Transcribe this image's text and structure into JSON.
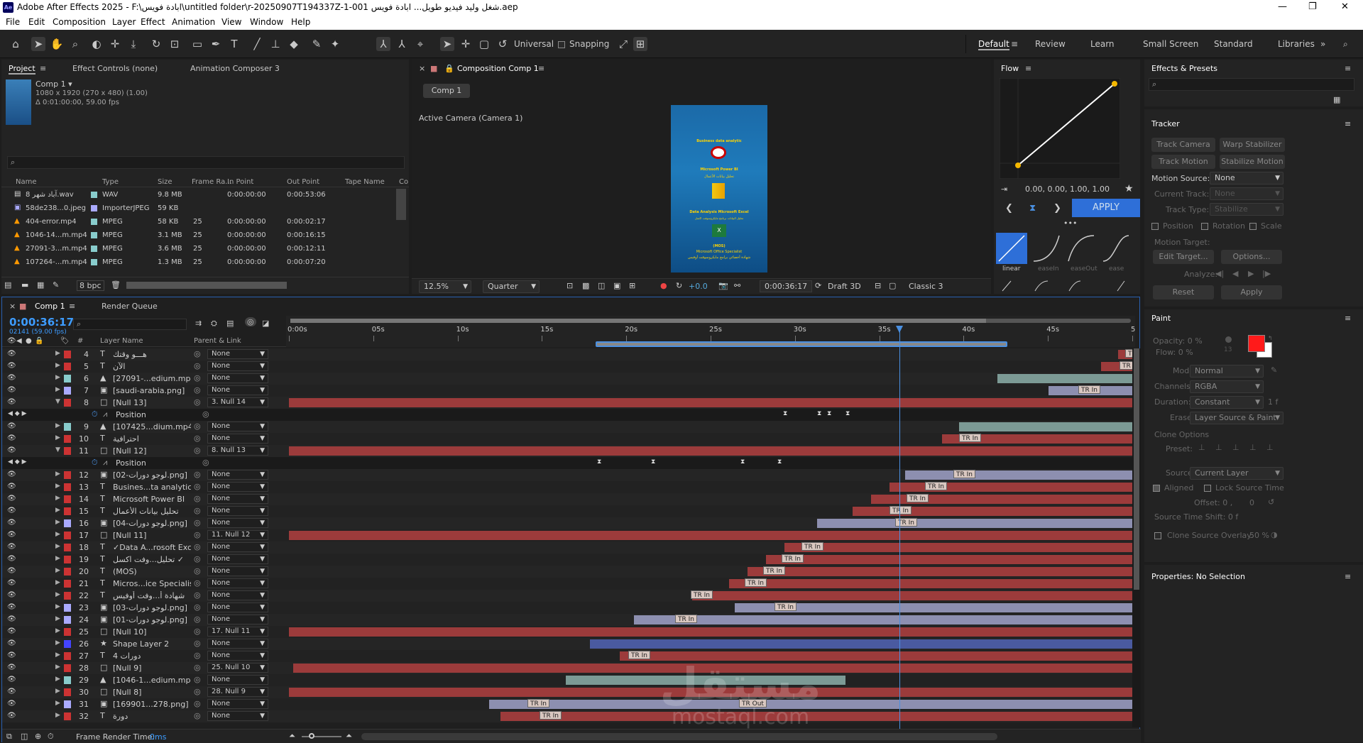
{
  "window": {
    "title": "Adobe After Effects 2025 - F:\\ابادة فويس\\untitled folder\\r-20250907T194337Z-1-001 شغل وليد فيديو طويل... ابادة فويس.aep",
    "min": "—",
    "max": "❐",
    "close": "✕",
    "logo": "Ae"
  },
  "menu": [
    "File",
    "Edit",
    "Composition",
    "Layer",
    "Effect",
    "Animation",
    "View",
    "Window",
    "Help"
  ],
  "toolbar": {
    "universal": "Universal",
    "snapping": "Snapping"
  },
  "workspaces": [
    "Default",
    "Review",
    "Learn",
    "Small Screen",
    "Standard",
    "Libraries"
  ],
  "project": {
    "tabs": [
      "Project",
      "Effect Controls (none)",
      "Animation Composer 3"
    ],
    "comp_name": "Comp 1 ▾",
    "comp_info1": "1080 x 1920  (270 x 480) (1.00)",
    "comp_info2": "Δ 0:01:00:00, 59.00 fps",
    "search_icon": "search-icon",
    "columns": [
      "Name",
      "Type",
      "Size",
      "Frame Ra...",
      "In Point",
      "Out Point",
      "Tape Name",
      "Co"
    ],
    "rows": [
      {
        "name": "8 آباد شهر.wav",
        "type": "WAV",
        "size": "9.8 MB",
        "fps": "",
        "in": "0:00:00:00",
        "out": "0:00:53:06"
      },
      {
        "name": "58de238...0.jpeg",
        "type": "ImporterJPEG",
        "size": "59 KB",
        "fps": "",
        "in": "",
        "out": ""
      },
      {
        "name": "404-error.mp4",
        "type": "MPEG",
        "size": "58 KB",
        "fps": "25",
        "in": "0:00:00:00",
        "out": "0:00:02:17"
      },
      {
        "name": "1046-14...m.mp4",
        "type": "MPEG",
        "size": "3.1 MB",
        "fps": "25",
        "in": "0:00:00:00",
        "out": "0:00:16:15"
      },
      {
        "name": "27091-3...m.mp4",
        "type": "MPEG",
        "size": "3.6 MB",
        "fps": "25",
        "in": "0:00:00:00",
        "out": "0:00:12:11"
      },
      {
        "name": "107264-...m.mp4",
        "type": "MPEG",
        "size": "1.3 MB",
        "fps": "25",
        "in": "0:00:00:00",
        "out": "0:00:07:20"
      }
    ],
    "bpc": "8 bpc"
  },
  "composition": {
    "tab": "Composition Comp 1",
    "crumb": "Comp 1",
    "camera": "Active Camera (Camera 1)",
    "zoom": "12.5%",
    "quality": "Quarter",
    "exposure": "+0.0",
    "time": "0:00:36:17",
    "renderer": "Draft 3D",
    "classic": "Classic 3",
    "preview_texts": [
      "Business data analytic",
      "Microsoft Power BI",
      "تحليل بيانات الأعمال",
      "Data Analysis Microsoft Excel",
      "تحليل البيانات برنامج مايكروسوفت اكسل",
      "(MOS)",
      "Microsoft Office Specialist",
      "شهادة أخصائي برامج مايكروسوفت أوفيس"
    ]
  },
  "flow": {
    "title": "Flow",
    "values": "0.00, 0.00, 1.00, 1.00",
    "apply": "APPLY",
    "presets": [
      "linear",
      "easeIn",
      "easeOut",
      "ease"
    ]
  },
  "effects": {
    "title": "Effects & Presets"
  },
  "tracker": {
    "title": "Tracker",
    "btns": [
      "Track Camera",
      "Warp Stabilizer",
      "Track Motion",
      "Stabilize Motion"
    ],
    "motion_source_label": "Motion Source:",
    "motion_source": "None",
    "current_track_label": "Current Track:",
    "current_track": "None",
    "track_type_label": "Track Type:",
    "track_type": "Stabilize",
    "position": "Position",
    "rotation": "Rotation",
    "scale": "Scale",
    "motion_target": "Motion Target:",
    "edit_target": "Edit Target...",
    "options": "Options...",
    "analyze": "Analyze:",
    "reset": "Reset",
    "apply": "Apply"
  },
  "paint": {
    "title": "Paint",
    "opacity": "Opacity:  0 %",
    "flow": "Flow:  0 %",
    "brush_size": "13",
    "mode_label": "Mode:",
    "mode": "Normal",
    "channels_label": "Channels:",
    "channels": "RGBA",
    "duration_label": "Duration:",
    "duration": "Constant",
    "duration_val": "1  f",
    "erase_label": "Erase:",
    "erase": "Layer Source & Paint",
    "clone_options": "Clone Options",
    "preset_label": "Preset:",
    "source_label": "Source:",
    "source": "Current Layer",
    "aligned": "Aligned",
    "lock_source": "Lock Source Time",
    "offset": "Offset: 0 ,",
    "offset2": "0",
    "source_time_shift": "Source Time Shift: 0  f",
    "clone_overlay": "Clone Source Overlay:",
    "clone_overlay_val": "50 %",
    "fg_color": "#ff1a1a",
    "bg_color": "#ffffff"
  },
  "properties": {
    "title": "Properties: No Selection"
  },
  "timeline": {
    "tab": "Comp 1",
    "render_queue": "Render Queue",
    "time": "0:00:36:17",
    "frame_info": "02141 (59.00 fps)",
    "col_layer": "Layer Name",
    "col_parent": "Parent & Link",
    "col_num": "#",
    "ticks": [
      "0:00s",
      "05s",
      "10s",
      "15s",
      "20s",
      "25s",
      "30s",
      "35s",
      "40s",
      "45s",
      "5"
    ],
    "frame_render": "Frame Render Time:",
    "frame_render_val": "0ms",
    "rows": [
      {
        "n": "4",
        "icon": "T",
        "name": "هـــو وقتك",
        "parent": "None",
        "color": "#c33"
      },
      {
        "n": "5",
        "icon": "T",
        "name": "الآن",
        "parent": "None",
        "color": "#c33"
      },
      {
        "n": "6",
        "icon": "▲",
        "name": "[27091-...edium.mp4]",
        "parent": "None",
        "color": "#8cc"
      },
      {
        "n": "7",
        "icon": "▣",
        "name": "[saudi-arabia.png]",
        "parent": "None",
        "color": "#aaf"
      },
      {
        "n": "8",
        "icon": "□",
        "name": "[Null 13]",
        "parent": "3. Null 14",
        "color": "#c33"
      },
      {
        "n": "",
        "icon": "",
        "name": "Position",
        "parent": "",
        "color": ""
      },
      {
        "n": "9",
        "icon": "▲",
        "name": "[107425...dium.mp4]",
        "parent": "None",
        "color": "#8cc"
      },
      {
        "n": "10",
        "icon": "T",
        "name": "احترافية",
        "parent": "None",
        "color": "#c33"
      },
      {
        "n": "11",
        "icon": "□",
        "name": "[Null 12]",
        "parent": "8. Null 13",
        "color": "#c33"
      },
      {
        "n": "",
        "icon": "",
        "name": "Position",
        "parent": "",
        "color": ""
      },
      {
        "n": "12",
        "icon": "▣",
        "name": "[02-لوجو دورات.png]",
        "parent": "None",
        "color": "#c33"
      },
      {
        "n": "13",
        "icon": "T",
        "name": "Busines...ta analytic",
        "parent": "None",
        "color": "#c33"
      },
      {
        "n": "14",
        "icon": "T",
        "name": "Microsoft Power BI",
        "parent": "None",
        "color": "#c33"
      },
      {
        "n": "15",
        "icon": "T",
        "name": "تحليل بيانات الأعمال",
        "parent": "None",
        "color": "#c33"
      },
      {
        "n": "16",
        "icon": "▣",
        "name": "[04-لوجو دورات.png]",
        "parent": "None",
        "color": "#aaf"
      },
      {
        "n": "17",
        "icon": "□",
        "name": "[Null 11]",
        "parent": "11. Null 12",
        "color": "#c33"
      },
      {
        "n": "18",
        "icon": "T",
        "name": "✓Data A...rosoft Excel",
        "parent": "None",
        "color": "#c33"
      },
      {
        "n": "19",
        "icon": "T",
        "name": "تحليل...وفت اكسل ✓",
        "parent": "None",
        "color": "#c33"
      },
      {
        "n": "20",
        "icon": "T",
        "name": "(MOS)",
        "parent": "None",
        "color": "#c33"
      },
      {
        "n": "21",
        "icon": "T",
        "name": "Micros...ice Specialist",
        "parent": "None",
        "color": "#c33"
      },
      {
        "n": "22",
        "icon": "T",
        "name": "شهادة أ...وفت أوفيس",
        "parent": "None",
        "color": "#c33"
      },
      {
        "n": "23",
        "icon": "▣",
        "name": "[03-لوجو دورات.png]",
        "parent": "None",
        "color": "#aaf"
      },
      {
        "n": "24",
        "icon": "▣",
        "name": "[01-لوجو دورات.png]",
        "parent": "None",
        "color": "#aaf"
      },
      {
        "n": "25",
        "icon": "□",
        "name": "[Null 10]",
        "parent": "17. Null 11",
        "color": "#c33"
      },
      {
        "n": "26",
        "icon": "★",
        "name": "Shape Layer 2",
        "parent": "None",
        "color": "#44f"
      },
      {
        "n": "27",
        "icon": "T",
        "name": "4 دورات",
        "parent": "None",
        "color": "#c33"
      },
      {
        "n": "28",
        "icon": "□",
        "name": "[Null 9]",
        "parent": "25. Null 10",
        "color": "#c33"
      },
      {
        "n": "29",
        "icon": "▲",
        "name": "[1046-1...edium.mp4]",
        "parent": "None",
        "color": "#8cc"
      },
      {
        "n": "30",
        "icon": "□",
        "name": "[Null 8]",
        "parent": "28. Null 9",
        "color": "#c33"
      },
      {
        "n": "31",
        "icon": "▣",
        "name": "[169901...278.png]",
        "parent": "None",
        "color": "#aaf"
      },
      {
        "n": "32",
        "icon": "T",
        "name": "دورة",
        "parent": "None",
        "color": "#c33"
      }
    ],
    "tr_in": "TR In",
    "tr_out": "TR Out"
  },
  "watermark": {
    "ar": "مستقل",
    "en": "mostaql.com"
  }
}
